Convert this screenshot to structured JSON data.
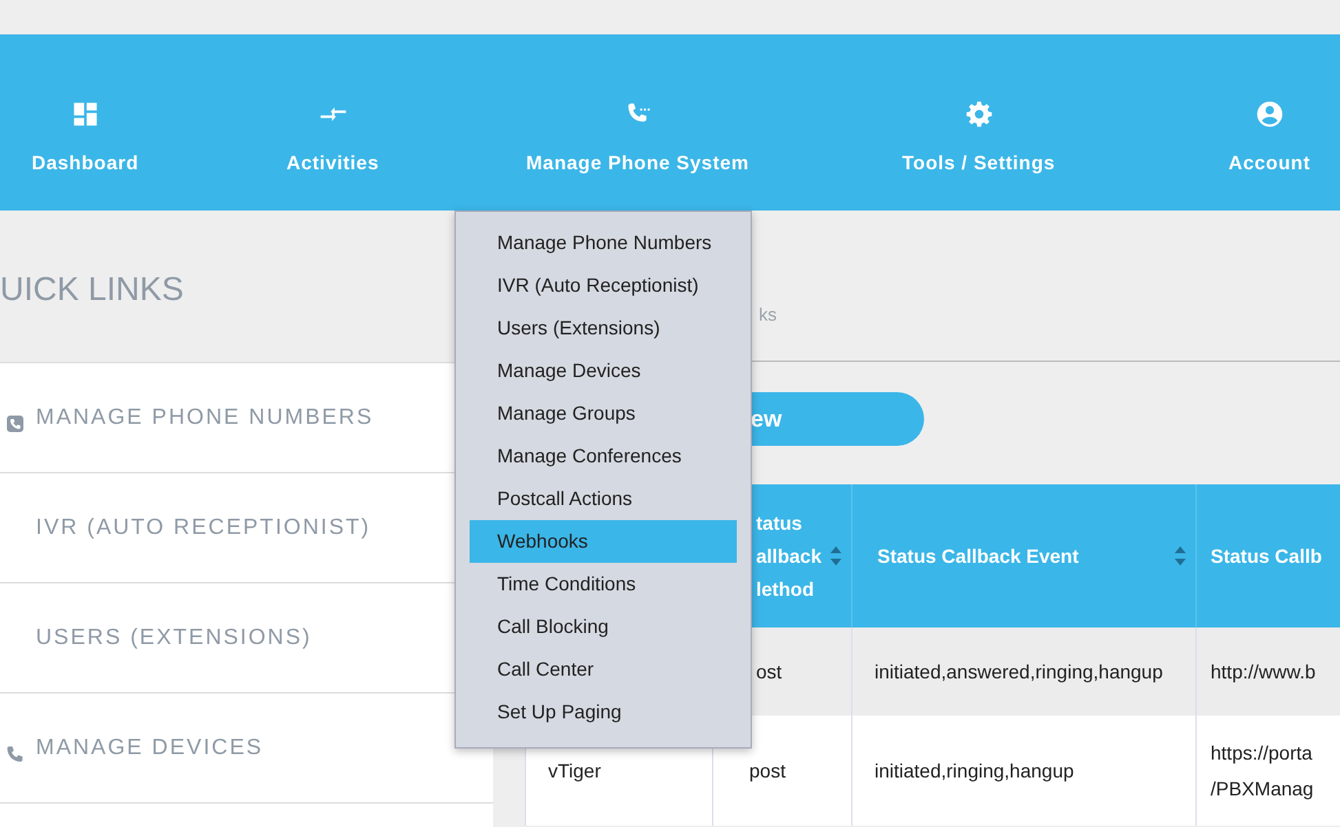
{
  "nav": [
    {
      "kind": "dashboard",
      "label": "Dashboard"
    },
    {
      "kind": "activities",
      "label": "Activities"
    },
    {
      "kind": "phone",
      "label": "Manage Phone System"
    },
    {
      "kind": "gear",
      "label": "Tools / Settings"
    },
    {
      "kind": "account",
      "label": "Account"
    }
  ],
  "quick_links": {
    "title": "UICK LINKS",
    "items": [
      {
        "kind": "phonebox",
        "label": "MANAGE PHONE NUMBERS"
      },
      {
        "kind": "plain",
        "label": "IVR (AUTO RECEPTIONIST)"
      },
      {
        "kind": "plain",
        "label": "USERS (EXTENSIONS)"
      },
      {
        "kind": "phone",
        "label": "MANAGE DEVICES"
      }
    ]
  },
  "breadcrumb": "ks",
  "add_button": "ew",
  "table": {
    "columns": [
      {},
      {
        "label": "tatus allback lethod",
        "sortable": true
      },
      {
        "label": "Status Callback Event",
        "sortable": true
      },
      {
        "label": "Status Callb"
      }
    ],
    "rows": [
      {
        "cells": [
          null,
          "ost",
          "initiated,answered,ringing,hangup",
          "http://www.b"
        ]
      },
      {
        "cells": [
          "vTiger",
          "post",
          "initiated,ringing,hangup",
          "https://porta /PBXManag"
        ]
      }
    ]
  },
  "dropdown": [
    {
      "label": "Manage Phone Numbers",
      "selected": false
    },
    {
      "label": "IVR (Auto Receptionist)",
      "selected": false
    },
    {
      "label": "Users (Extensions)",
      "selected": false
    },
    {
      "label": "Manage Devices",
      "selected": false
    },
    {
      "label": "Manage Groups",
      "selected": false
    },
    {
      "label": "Manage Conferences",
      "selected": false
    },
    {
      "label": "Postcall Actions",
      "selected": false
    },
    {
      "label": "Webhooks",
      "selected": true
    },
    {
      "label": "Time Conditions",
      "selected": false
    },
    {
      "label": "Call Blocking",
      "selected": false
    },
    {
      "label": "Call Center",
      "selected": false
    },
    {
      "label": "Set Up Paging",
      "selected": false
    }
  ]
}
